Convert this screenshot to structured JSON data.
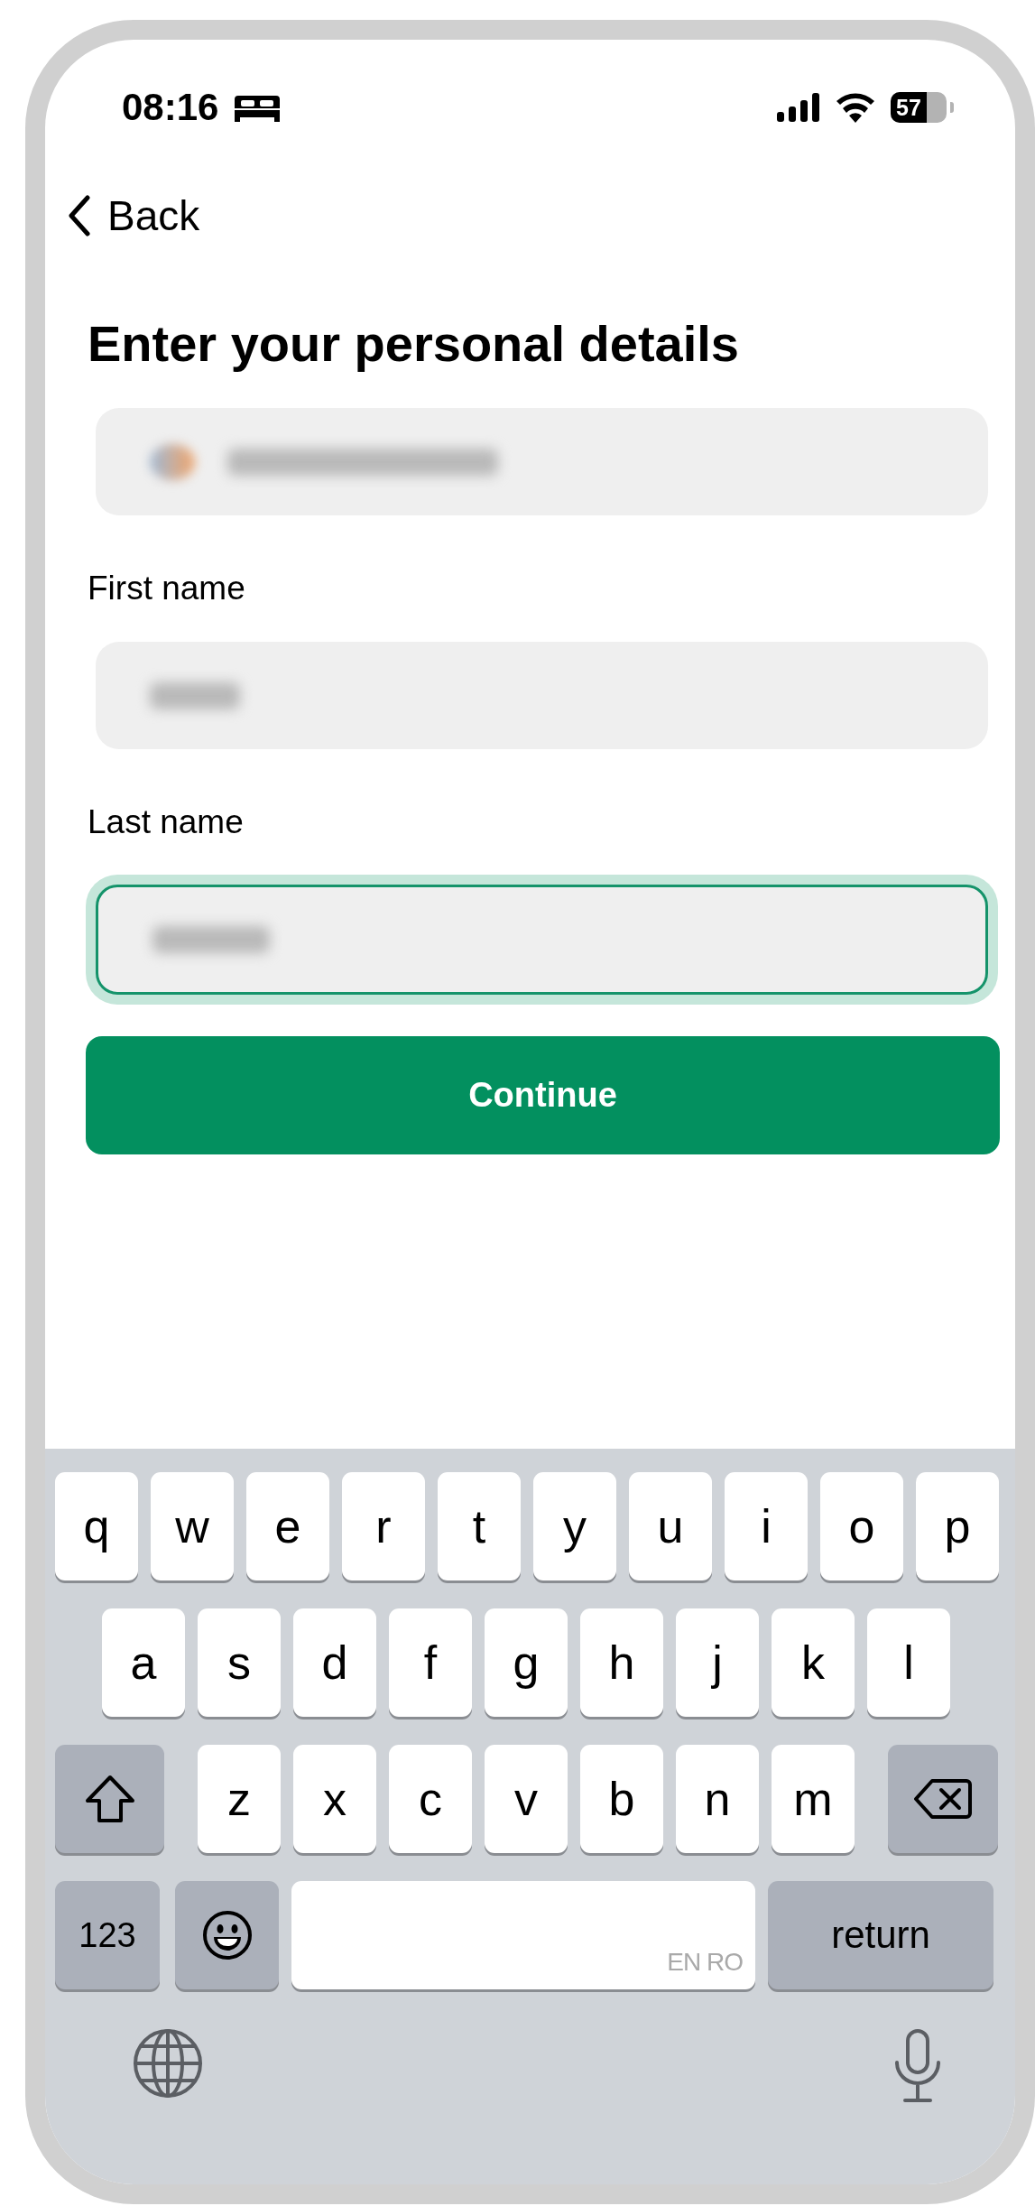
{
  "status_bar": {
    "time": "08:16",
    "battery": "57"
  },
  "nav": {
    "back": "Back"
  },
  "title": "Enter your personal details",
  "fields": [
    {
      "kind": "phone",
      "focused": false
    },
    {
      "kind": "text",
      "label": "First name",
      "focused": false
    },
    {
      "kind": "text",
      "label": "Last name",
      "focused": true
    }
  ],
  "button": "Continue",
  "keyboard": {
    "letter_rows": [
      [
        {
          "kind": "letter",
          "label": "q"
        },
        {
          "kind": "letter",
          "label": "w"
        },
        {
          "kind": "letter",
          "label": "e"
        },
        {
          "kind": "letter",
          "label": "r"
        },
        {
          "kind": "letter",
          "label": "t"
        },
        {
          "kind": "letter",
          "label": "y"
        },
        {
          "kind": "letter",
          "label": "u"
        },
        {
          "kind": "letter",
          "label": "i"
        },
        {
          "kind": "letter",
          "label": "o"
        },
        {
          "kind": "letter",
          "label": "p"
        }
      ],
      [
        {
          "kind": "letter",
          "label": "a"
        },
        {
          "kind": "letter",
          "label": "s"
        },
        {
          "kind": "letter",
          "label": "d"
        },
        {
          "kind": "letter",
          "label": "f"
        },
        {
          "kind": "letter",
          "label": "g"
        },
        {
          "kind": "letter",
          "label": "h"
        },
        {
          "kind": "letter",
          "label": "j"
        },
        {
          "kind": "letter",
          "label": "k"
        },
        {
          "kind": "letter",
          "label": "l"
        }
      ],
      [
        {
          "kind": "shift"
        },
        {
          "kind": "letter",
          "label": "z"
        },
        {
          "kind": "letter",
          "label": "x"
        },
        {
          "kind": "letter",
          "label": "c"
        },
        {
          "kind": "letter",
          "label": "v"
        },
        {
          "kind": "letter",
          "label": "b"
        },
        {
          "kind": "letter",
          "label": "n"
        },
        {
          "kind": "letter",
          "label": "m"
        },
        {
          "kind": "delete"
        }
      ]
    ],
    "numbers_key": "123",
    "space_key": "EN RO",
    "return_key": "return"
  }
}
